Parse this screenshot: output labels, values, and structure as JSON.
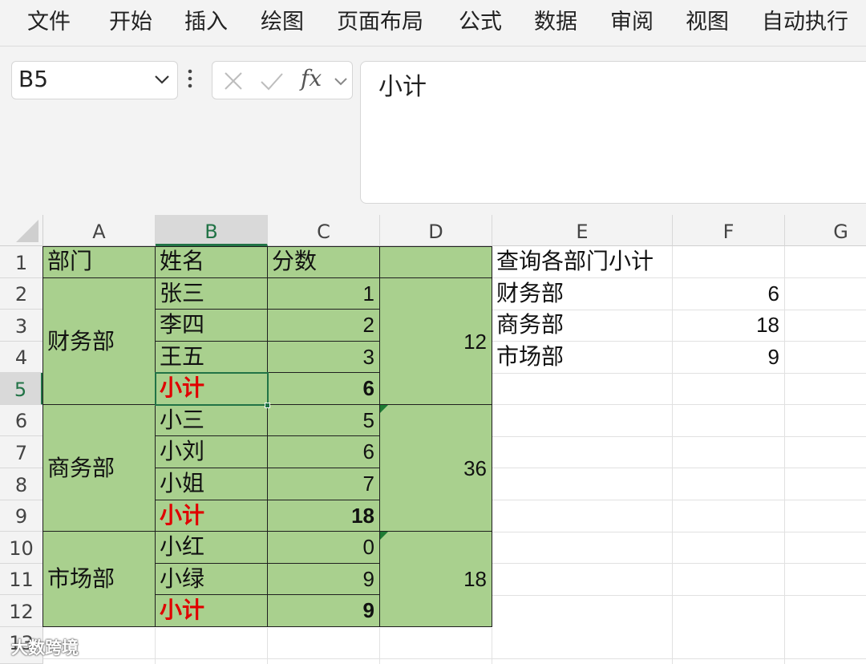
{
  "ribbon": {
    "tabs": [
      "文件",
      "开始",
      "插入",
      "绘图",
      "页面布局",
      "公式",
      "数据",
      "审阅",
      "视图",
      "自动执行"
    ]
  },
  "formula_bar": {
    "name_box": "B5",
    "fx_label": "fx",
    "content": "小计"
  },
  "grid": {
    "columns": [
      "A",
      "B",
      "C",
      "D",
      "E",
      "F",
      "G"
    ],
    "rows": [
      "1",
      "2",
      "3",
      "4",
      "5",
      "6",
      "7",
      "8",
      "9",
      "10",
      "11",
      "12",
      "13"
    ],
    "selected_cell": "B5",
    "headers": {
      "a1": "部门",
      "b1": "姓名",
      "c1": "分数"
    },
    "departments": [
      {
        "name": "财务部",
        "total": "12",
        "members": [
          {
            "name": "张三",
            "score": "1"
          },
          {
            "name": "李四",
            "score": "2"
          },
          {
            "name": "王五",
            "score": "3"
          }
        ],
        "subtotal_label": "小计",
        "subtotal_value": "6"
      },
      {
        "name": "商务部",
        "total": "36",
        "members": [
          {
            "name": "小三",
            "score": "5"
          },
          {
            "name": "小刘",
            "score": "6"
          },
          {
            "name": "小姐",
            "score": "7"
          }
        ],
        "subtotal_label": "小计",
        "subtotal_value": "18"
      },
      {
        "name": "市场部",
        "total": "18",
        "members": [
          {
            "name": "小红",
            "score": "0"
          },
          {
            "name": "小绿",
            "score": "9"
          }
        ],
        "subtotal_label": "小计",
        "subtotal_value": "9"
      }
    ],
    "lookup": {
      "title": "查询各部门小计",
      "rows": [
        {
          "dept": "财务部",
          "value": "6"
        },
        {
          "dept": "商务部",
          "value": "18"
        },
        {
          "dept": "市场部",
          "value": "9"
        }
      ]
    }
  },
  "colors": {
    "fill_green": "#a9d08e",
    "subtotal_red": "#e00000",
    "accent": "#217346"
  },
  "watermark": "大数跨境"
}
